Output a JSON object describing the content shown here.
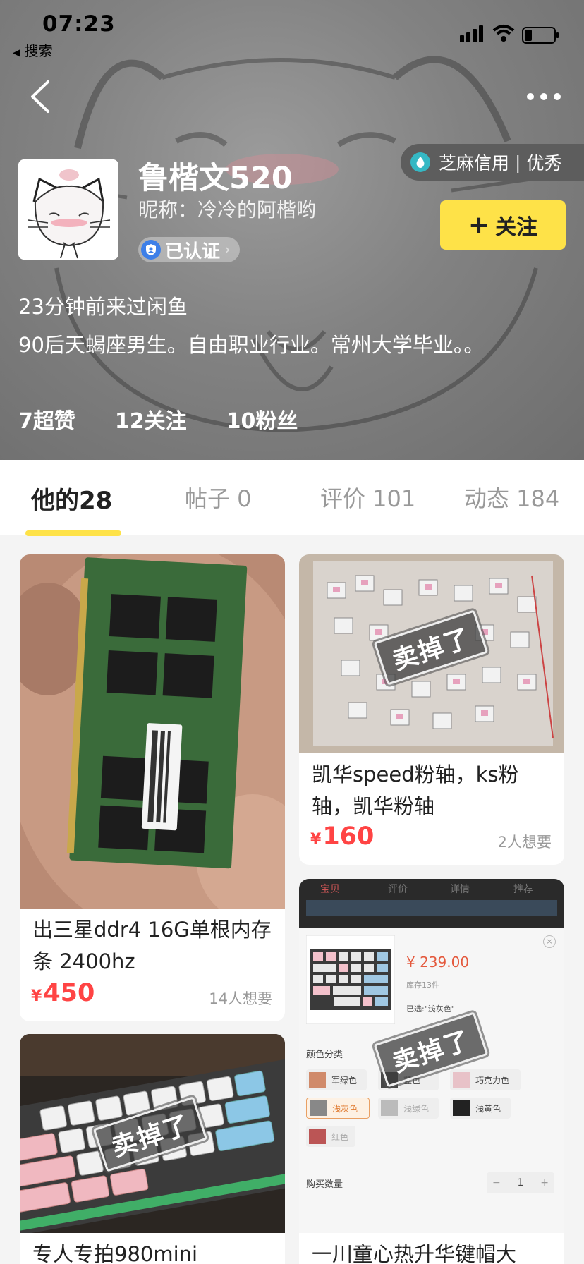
{
  "status_bar": {
    "time": "07:23",
    "back_app": "搜索"
  },
  "profile": {
    "username": "鲁楷文520",
    "nickname": "昵称：冷冷的阿楷哟",
    "verified_label": "已认证",
    "credit_label": "芝麻信用",
    "credit_level": "优秀",
    "follow_label": "关注",
    "last_seen": "23分钟前来过闲鱼",
    "bio": "90后天蝎座男生。自由职业行业。常州大学毕业。。",
    "stats": {
      "likes": "7超赞",
      "following": "12关注",
      "followers": "10粉丝"
    }
  },
  "tabs": [
    {
      "label": "他的28"
    },
    {
      "label": "帖子 0"
    },
    {
      "label": "评价 101"
    },
    {
      "label": "动态 184"
    }
  ],
  "items": [
    {
      "title": "出三星ddr4  16G单根内存条  2400hz",
      "currency": "¥",
      "price": "450",
      "wants": "14人想要"
    },
    {
      "title": "凯华speed粉轴，ks粉轴，凯华粉轴",
      "currency": "¥",
      "price": "160",
      "wants": "2人想要",
      "sold": "卖掉了"
    },
    {
      "title": "专人专拍980mini",
      "sold": "卖掉了"
    },
    {
      "title": "一川童心热升华键帽大",
      "sold": "卖掉了",
      "screenshot": {
        "price": "¥ 239.00",
        "stock": "库存13件",
        "selected": "已选:\"浅灰色\"",
        "color_label": "颜色分类",
        "colors": [
          "军绿色",
          "蓝色",
          "巧克力色",
          "浅灰色",
          "浅绿色",
          "浅黄色",
          "红色"
        ],
        "qty_label": "购买数量",
        "qty": "1",
        "tabs": [
          "宝贝",
          "评价",
          "详情",
          "推荐"
        ]
      }
    }
  ],
  "colors": {
    "accent": "#fee248",
    "price": "#ff4444"
  }
}
